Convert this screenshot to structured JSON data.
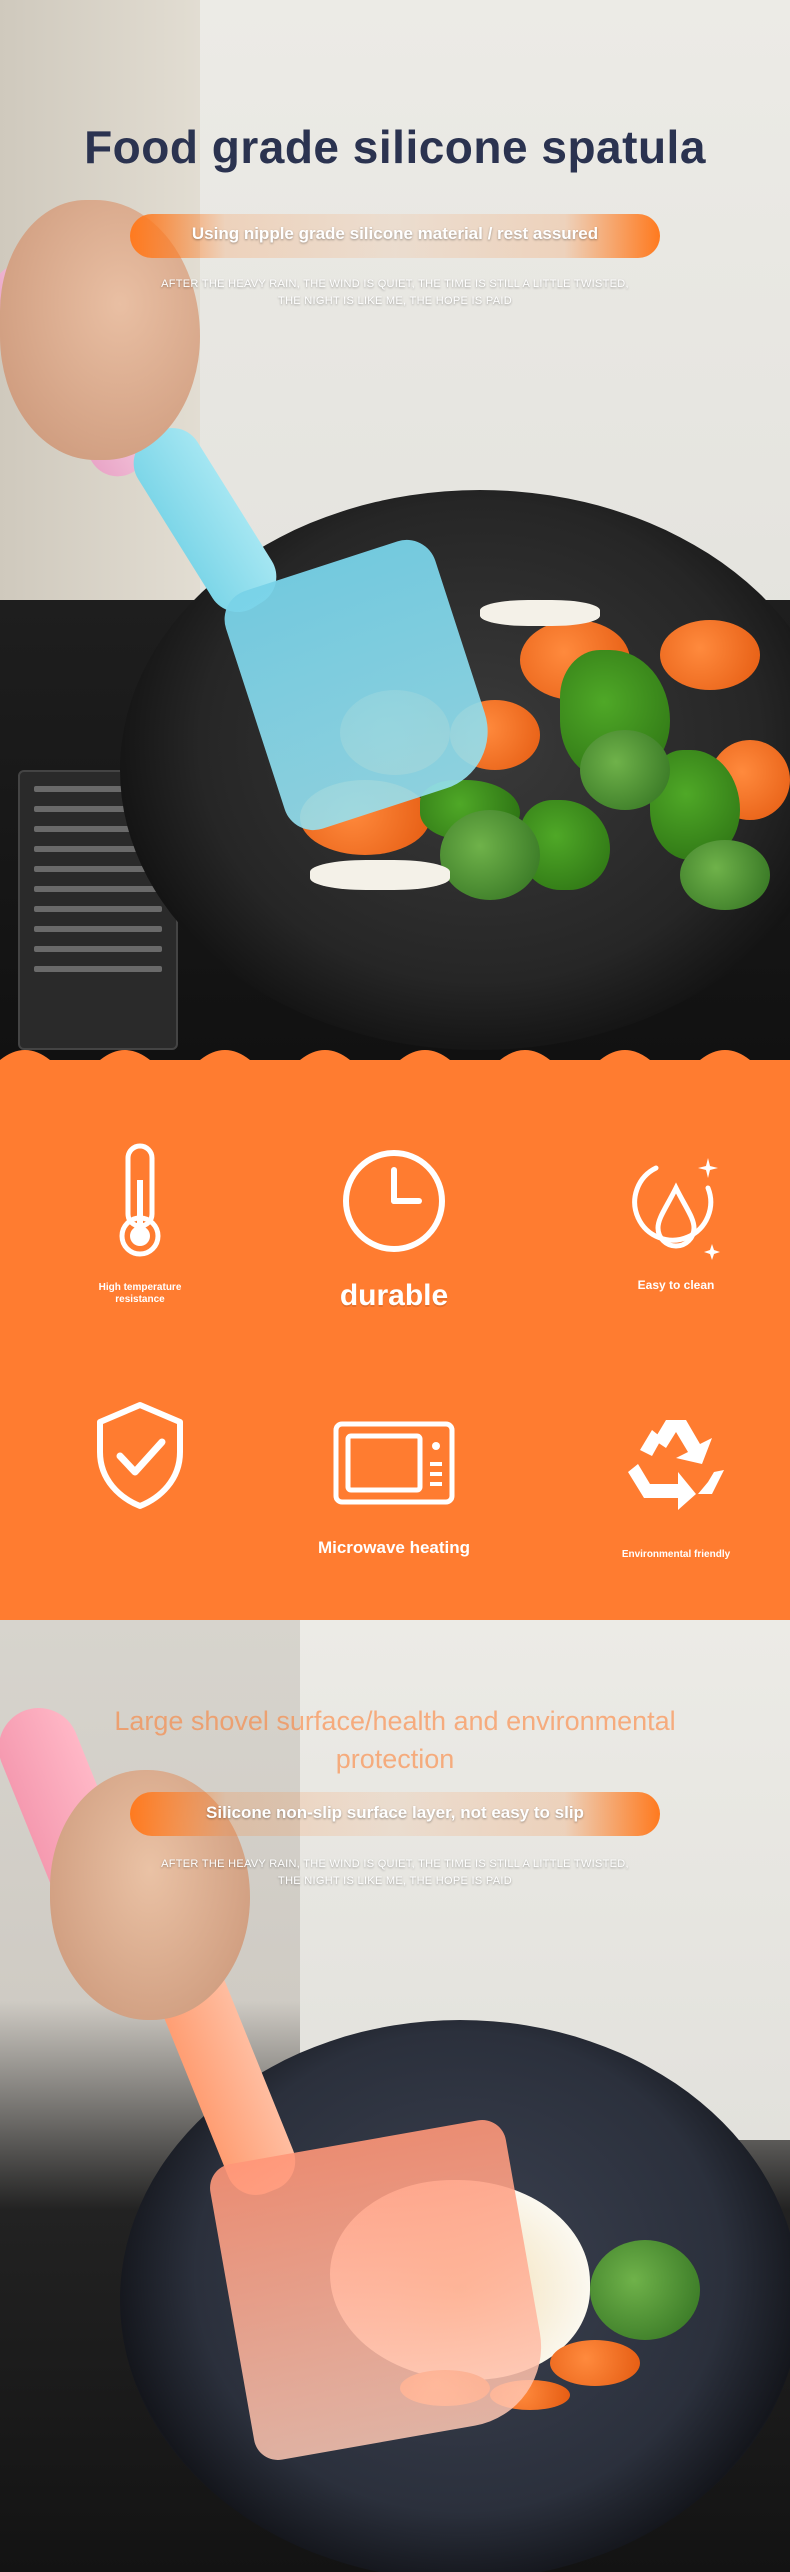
{
  "hero": {
    "title": "Food grade silicone spatula",
    "subtitle": "Using nipple grade silicone material / rest assured",
    "tagline_line1": "AFTER THE HEAVY RAIN, THE WIND IS QUIET, THE TIME IS STILL A LITTLE TWISTED,",
    "tagline_line2": "THE NIGHT IS LIKE ME, THE HOPE IS PAID",
    "spatula_colors": {
      "handle": "#e9a5c7",
      "blade": "#7dd6e8"
    }
  },
  "features": {
    "background_color": "#ff7c30",
    "items": [
      {
        "icon": "thermometer-icon",
        "label": "High temperature resistance"
      },
      {
        "icon": "clock-icon",
        "label": "durable"
      },
      {
        "icon": "water-drop-icon",
        "label": "Easy to clean"
      },
      {
        "icon": "shield-check-icon",
        "label": ""
      },
      {
        "icon": "microwave-icon",
        "label": "Microwave heating"
      },
      {
        "icon": "recycle-icon",
        "label": "Environmental friendly"
      }
    ]
  },
  "section2": {
    "title": "Large shovel surface/health and environmental protection",
    "subtitle": "Silicone non-slip surface layer, not easy to slip",
    "tagline_line1": "AFTER THE HEAVY RAIN, THE WIND IS QUIET, THE TIME IS STILL A LITTLE TWISTED,",
    "tagline_line2": "THE NIGHT IS LIKE ME, THE HOPE IS PAID",
    "spatula_colors": {
      "handle": "#f59ab0",
      "blade": "#ff9e73"
    }
  }
}
